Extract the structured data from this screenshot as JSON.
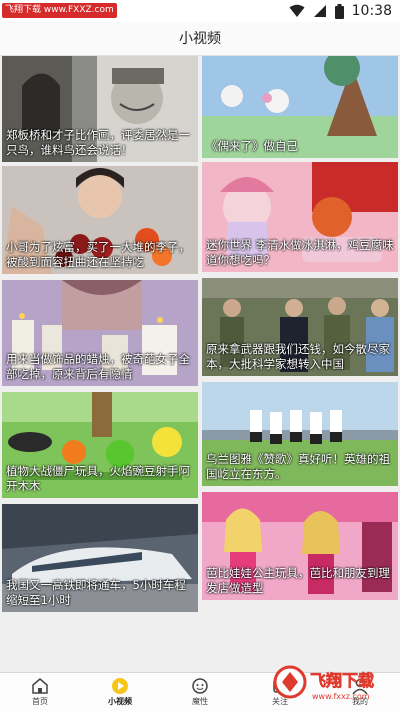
{
  "status": {
    "watermark": "飞翔下载 www.FXXZ.com",
    "time": "10:38"
  },
  "header": {
    "title": "小视频"
  },
  "cards": [
    {
      "caption": "郑板桥和才子比作画，评委居然是一只鸟，谁料鸟还会说话！"
    },
    {
      "caption": "《偶来了》做自己"
    },
    {
      "caption": "小哥为了炫富，买了一大堆的李子，被酸到面容扭曲还在坚持吃"
    },
    {
      "caption": "迷你世界 李清水做冰淇淋，鸡豆腐味道你想吃吗？"
    },
    {
      "caption": "用来当做饰品的蜡烛，被奇葩女子全部吃掉，原来背后有隐情"
    },
    {
      "caption": "原来拿武器跟我们还钱，如今散尽家本，大批科学家想转入中国"
    },
    {
      "caption": "植物大战僵尸玩具，火焰豌豆射手阿开木木"
    },
    {
      "caption": "乌兰图雅《赞歌》真好听！英雄的祖国屹立在东方。"
    },
    {
      "caption": "我国又一高铁即将通车，5小时车程缩短至1小时"
    },
    {
      "caption": "芭比娃娃公主玩具，芭比和朋友到理发店做造型"
    }
  ],
  "tabs": [
    {
      "label": "首页",
      "icon": "home-icon"
    },
    {
      "label": "小视频",
      "icon": "play-icon"
    },
    {
      "label": "魔性",
      "icon": "face-icon"
    },
    {
      "label": "关注",
      "icon": "follow-icon"
    },
    {
      "label": "我的",
      "icon": "user-icon"
    }
  ],
  "logo": {
    "text": "飞翔下载",
    "sub": "www.fxxz.com"
  }
}
